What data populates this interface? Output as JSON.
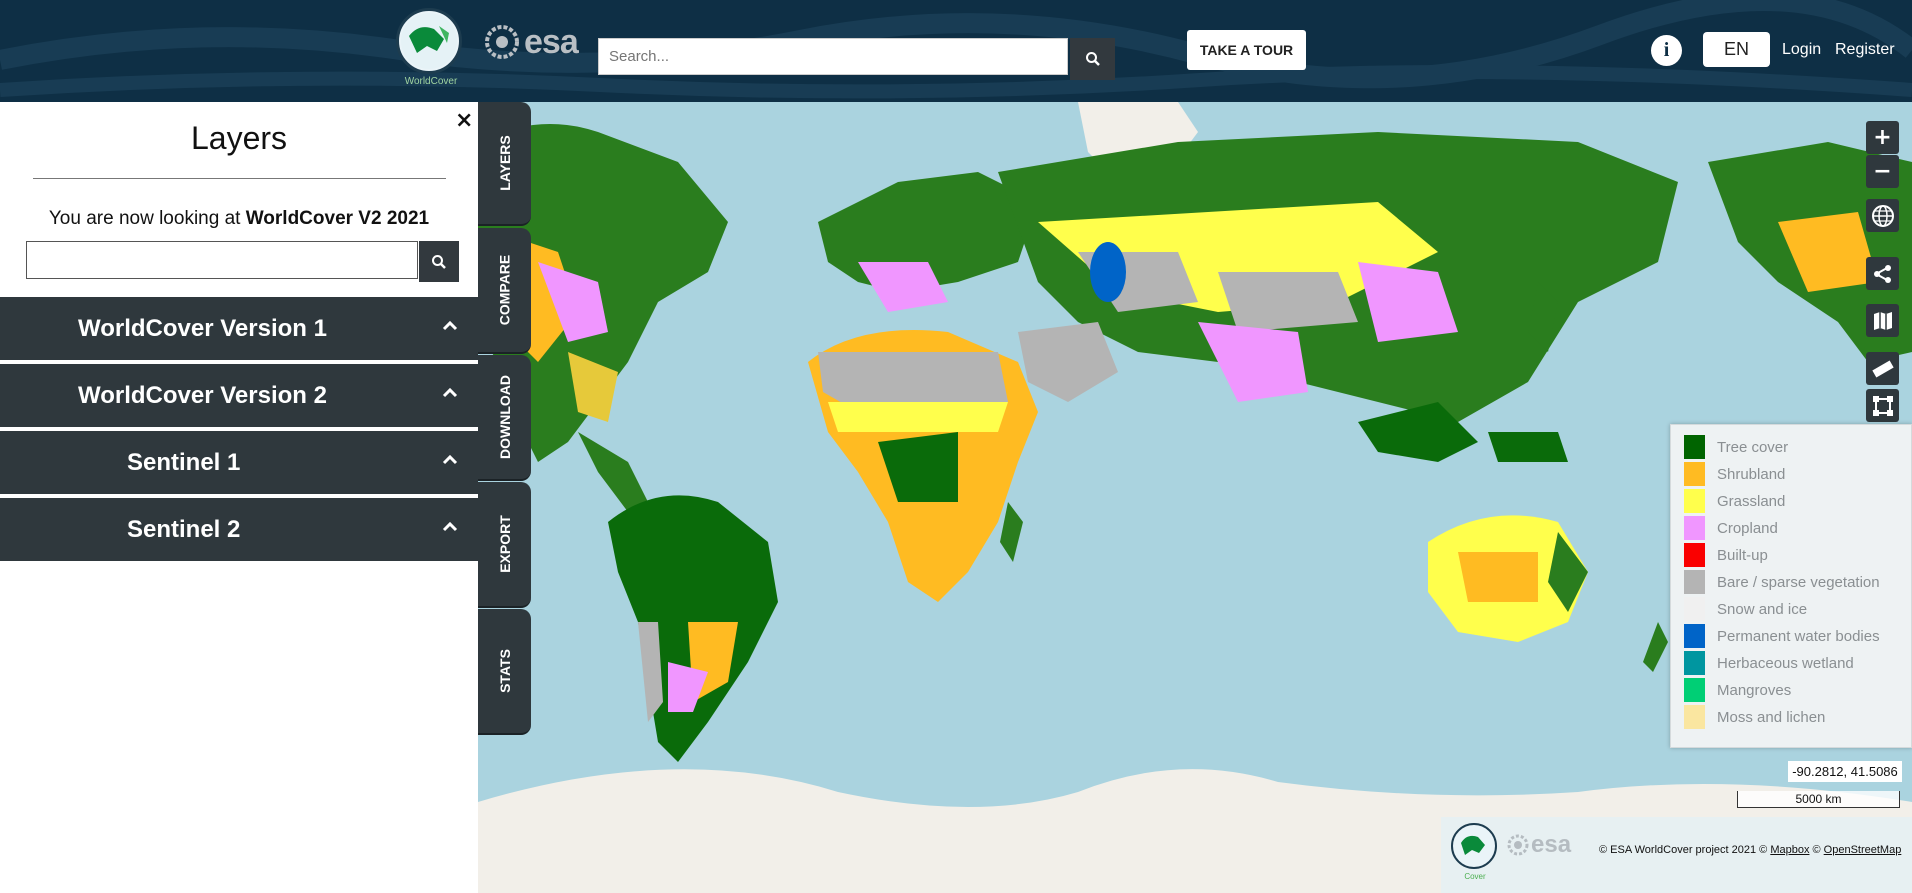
{
  "header": {
    "logo_label": "WorldCover",
    "esa_logo_text": "esa",
    "search_placeholder": "Search...",
    "tour_label": "TAKE A TOUR",
    "info_label": "i",
    "language": "EN",
    "login_label": "Login",
    "register_label": "Register"
  },
  "sidebar": {
    "close_label": "×",
    "title": "Layers",
    "looking_prefix": "You are now looking at ",
    "looking_value": "WorldCover V2 2021",
    "groups": [
      {
        "label": "WorldCover Version 1"
      },
      {
        "label": "WorldCover Version 2"
      },
      {
        "label": "Sentinel 1"
      },
      {
        "label": "Sentinel 2"
      }
    ]
  },
  "tabs": [
    "LAYERS",
    "COMPARE",
    "DOWNLOAD",
    "EXPORT",
    "STATS"
  ],
  "map_controls": {
    "zoom_in": "+",
    "zoom_out": "−",
    "icons": [
      "globe-icon",
      "share-icon",
      "map-icon",
      "ruler-icon",
      "draw-area-icon"
    ]
  },
  "legend": {
    "items": [
      {
        "label": "Tree cover",
        "color": "#006400"
      },
      {
        "label": "Shrubland",
        "color": "#ffbb22"
      },
      {
        "label": "Grassland",
        "color": "#ffff4c"
      },
      {
        "label": "Cropland",
        "color": "#f096ff"
      },
      {
        "label": "Built-up",
        "color": "#fa0000"
      },
      {
        "label": "Bare / sparse vegetation",
        "color": "#b4b4b4"
      },
      {
        "label": "Snow and ice",
        "color": "#f0f0f0"
      },
      {
        "label": "Permanent water bodies",
        "color": "#0064c8"
      },
      {
        "label": "Herbaceous wetland",
        "color": "#0096a0"
      },
      {
        "label": "Mangroves",
        "color": "#00cf75"
      },
      {
        "label": "Moss and lichen",
        "color": "#fae6a0"
      }
    ]
  },
  "coordinates": "-90.2812, 41.5086",
  "scale_label": "5000 km",
  "attribution": {
    "prefix": "© ESA WorldCover project 2021 © ",
    "mapbox": "Mapbox",
    "sep": " © ",
    "osm": "OpenStreetMap",
    "logo_label": "Cover",
    "esa_text": "esa"
  }
}
